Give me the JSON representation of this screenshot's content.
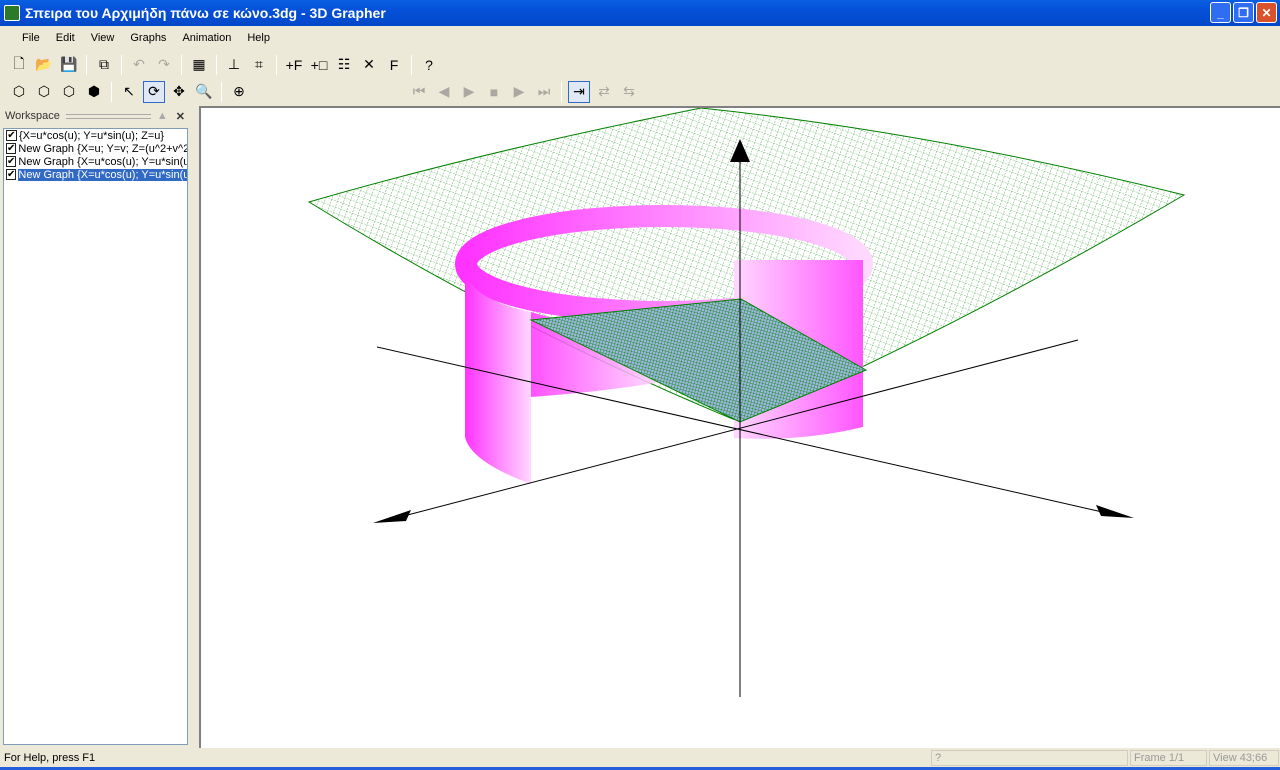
{
  "window": {
    "title": "Σπειρα του Αρχιμήδη πάνω σε κώνο.3dg - 3D Grapher"
  },
  "menu": [
    "File",
    "Edit",
    "View",
    "Graphs",
    "Animation",
    "Help"
  ],
  "toolbar1": [
    {
      "icon": "new-icon",
      "g": "🗋"
    },
    {
      "icon": "open-icon",
      "g": "📂"
    },
    {
      "icon": "save-icon",
      "g": "💾"
    },
    {
      "icon": "copy-icon",
      "g": "⧉"
    },
    {
      "icon": "undo-icon",
      "g": "↶"
    },
    {
      "icon": "redo-icon",
      "g": "↷"
    },
    {
      "icon": "properties-icon",
      "g": "▦"
    },
    {
      "icon": "axes-icon",
      "g": "⊥"
    },
    {
      "icon": "grid-icon",
      "g": "⌗"
    },
    {
      "icon": "add-function-icon",
      "g": "+F"
    },
    {
      "icon": "add-graph-icon",
      "g": "+□"
    },
    {
      "icon": "graph-properties-icon",
      "g": "☷"
    },
    {
      "icon": "delete-icon",
      "g": "✕"
    },
    {
      "icon": "function-icon",
      "g": "F"
    },
    {
      "icon": "help-icon",
      "g": "?"
    }
  ],
  "toolbar2": [
    {
      "icon": "view-front-icon",
      "g": "⬡"
    },
    {
      "icon": "view-side-icon",
      "g": "⬡"
    },
    {
      "icon": "view-top-icon",
      "g": "⬡"
    },
    {
      "icon": "view-3d-icon",
      "g": "⬢"
    },
    {
      "icon": "select-icon",
      "g": "↖"
    },
    {
      "icon": "rotate-icon",
      "g": "⟳"
    },
    {
      "icon": "move-icon",
      "g": "✥"
    },
    {
      "icon": "zoom-icon",
      "g": "🔍"
    },
    {
      "icon": "zoom-fit-icon",
      "g": "⊕"
    }
  ],
  "animation": [
    {
      "icon": "first-frame-icon",
      "g": "⏮"
    },
    {
      "icon": "prev-frame-icon",
      "g": "◀"
    },
    {
      "icon": "play-icon",
      "g": "▶"
    },
    {
      "icon": "stop-icon",
      "g": "■"
    },
    {
      "icon": "next-frame-icon",
      "g": "▶"
    },
    {
      "icon": "last-frame-icon",
      "g": "⏭"
    },
    {
      "icon": "play-once-icon",
      "g": "⇥"
    },
    {
      "icon": "loop-icon",
      "g": "⇄"
    },
    {
      "icon": "bounce-icon",
      "g": "⇆"
    }
  ],
  "workspace": {
    "title": "Workspace",
    "items": [
      {
        "label": " {X=u*cos(u); Y=u*sin(u); Z=u}",
        "checked": true
      },
      {
        "label": "New Graph {X=u; Y=v; Z=(u^2+v^2",
        "checked": true
      },
      {
        "label": "New Graph {X=u*cos(u); Y=u*sin(u)",
        "checked": true
      },
      {
        "label": "New Graph {X=u*cos(u); Y=u*sin(u)",
        "checked": true,
        "selected": true
      }
    ]
  },
  "status": {
    "help": "For Help, press F1",
    "mode": "?",
    "frame": "Frame 1/1",
    "view": "View 43;66"
  },
  "colors": {
    "surface": "#008000",
    "ribbon": "#ff44ff",
    "axes": "#000000",
    "titlebar": "#0550d8"
  }
}
